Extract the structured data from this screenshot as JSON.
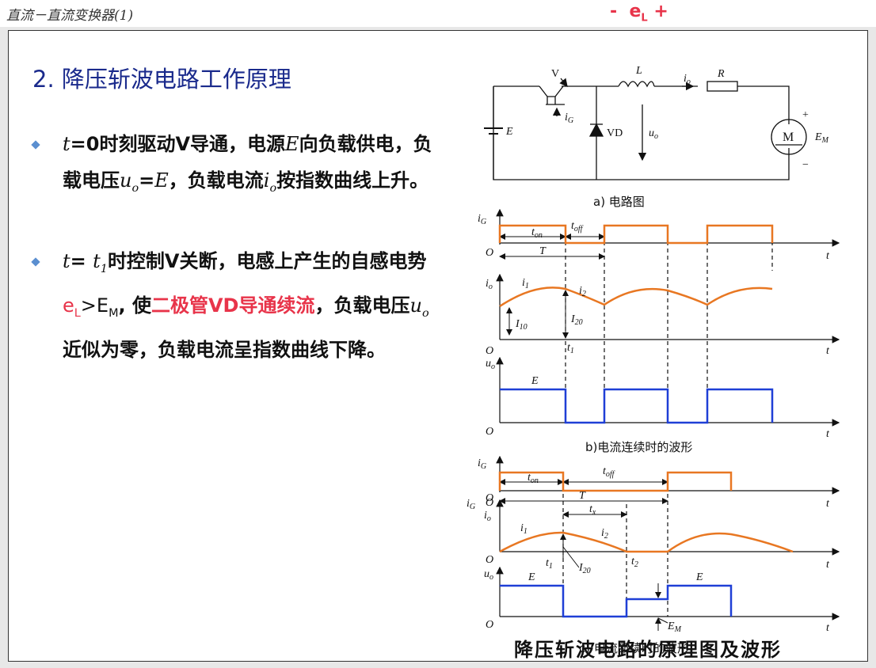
{
  "window": {
    "title": "直流－直流变换器(1)"
  },
  "top_annotation": {
    "minus": "-",
    "e": "e",
    "sub": "L",
    "plus": "+"
  },
  "slide": {
    "heading": "2. 降压斩波电路工作原理",
    "bullet1": {
      "p1": "t",
      "p2": "=0时刻驱动V导通，电源",
      "p3": "E",
      "p4": "向负载供电，负载电压",
      "p5": "u",
      "p5sub": "o",
      "p6": "=",
      "p7": "E",
      "p8": "，负载电流",
      "p9": "i",
      "p9sub": "o",
      "p10": "按指数曲线上升。"
    },
    "bullet2": {
      "p1": "t",
      "p2": "= ",
      "p3": "t",
      "p3sub": "1",
      "p4": "时控制V关断，电感上产生的自感电势",
      "p5": "e",
      "p5sub": "L",
      "p6": ">E",
      "p6sub": "M",
      "p7": ", 使",
      "p8": "二极管VD导通续流",
      "p9": "，负载电压",
      "p10": "u",
      "p10sub": "o",
      "p11": "近似为零，负载电流呈指数曲线下降。"
    },
    "caption_bottom": "降压斩波电路的原理图及波形"
  },
  "diagram": {
    "circuit_labels": {
      "V": "V",
      "iG": "i",
      "iG_sub": "G",
      "E": "E",
      "VD": "VD",
      "uo": "u",
      "uo_sub": "o",
      "L": "L",
      "io": "i",
      "io_sub": "o",
      "R": "R",
      "M": "M",
      "EM": "E",
      "EM_sub": "M",
      "plus": "+",
      "minus": "−",
      "caption": "a)  电路图"
    },
    "continuous": {
      "iG": "i",
      "iG_sub": "G",
      "O1": "O",
      "ton": "t",
      "ton_sub": "on",
      "toff": "t",
      "toff_sub": "off",
      "T": "T",
      "t": "t",
      "io": "i",
      "io_sub": "o",
      "i1": "i",
      "i1_sub": "1",
      "i2": "i",
      "i2_sub": "2",
      "I10": "I",
      "I10_sub": "10",
      "I20": "I",
      "I20_sub": "20",
      "O2": "O",
      "t1": "t",
      "t1_sub": "1",
      "uo": "u",
      "uo_sub": "o",
      "E": "E",
      "O3": "O",
      "caption": "b)电流连续时的波形"
    },
    "discontinuous": {
      "iG": "i",
      "iG_sub": "G",
      "O1": "O",
      "ton": "t",
      "ton_sub": "on",
      "toff": "t",
      "toff_sub": "off",
      "iG2": "i",
      "iG2_sub": "G",
      "O2": "O",
      "T": "T",
      "tx": "t",
      "tx_sub": "x",
      "io": "i",
      "io_sub": "o",
      "i1": "i",
      "i1_sub": "1",
      "i2": "i",
      "i2_sub": "2",
      "O3": "O",
      "t1": "t",
      "t1_sub": "1",
      "I20": "I",
      "I20_sub": "20",
      "t2": "t",
      "t2_sub": "2",
      "uo": "u",
      "uo_sub": "o",
      "E1": "E",
      "E2": "E",
      "O4": "O",
      "EM": "E",
      "EM_sub": "M",
      "t": "t",
      "caption": "c)  电流断续时的波形"
    },
    "colors": {
      "gate": "#e87722",
      "current": "#e87722",
      "voltage": "#1f3fd6",
      "axis": "#111111"
    }
  }
}
